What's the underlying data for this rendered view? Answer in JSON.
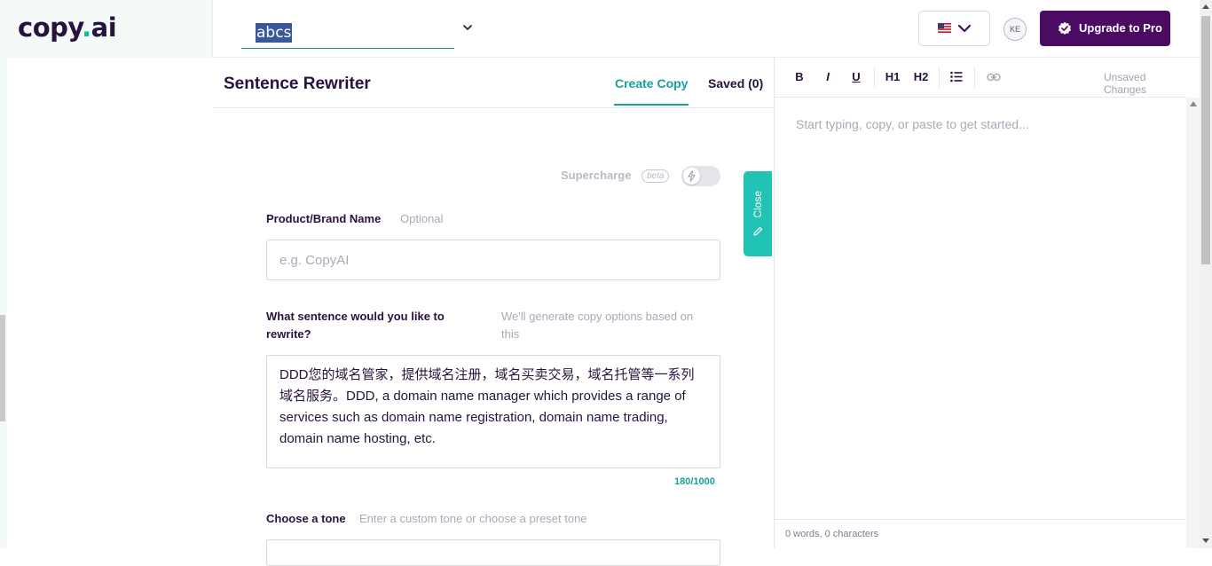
{
  "app": {
    "logo_text": "copy",
    "logo_dot": ".",
    "logo_suffix": "ai"
  },
  "header": {
    "project_name": "abcs",
    "language_flag": "US flag",
    "avatar_initials": "KE",
    "upgrade_label": "Upgrade to Pro"
  },
  "tool": {
    "title": "Sentence Rewriter",
    "tabs": [
      {
        "label": "Create Copy",
        "active": true
      },
      {
        "label": "Saved (0)",
        "active": false
      }
    ],
    "supercharge_label": "Supercharge",
    "beta_label": "beta",
    "close_label": "Close"
  },
  "form": {
    "brand": {
      "label": "Product/Brand Name",
      "hint": "Optional",
      "placeholder": "e.g. CopyAI",
      "value": ""
    },
    "sentence": {
      "label_line1": "What sentence would you like to",
      "label_line2": "rewrite?",
      "hint_line1": "We'll generate copy options based on",
      "hint_line2": "this",
      "value": "DDD您的域名管家，提供域名注册，域名买卖交易，域名托管等一系列域名服务。DDD, a domain name manager which provides a range of services such as domain name registration, domain name trading, domain name hosting, etc.",
      "char_count": "180/1000"
    },
    "tone": {
      "label": "Choose a tone",
      "hint": "Enter a custom tone or choose a preset tone"
    }
  },
  "editor": {
    "toolbar": {
      "bold": "B",
      "italic": "I",
      "underline": "U",
      "h1": "H1",
      "h2": "H2"
    },
    "status": "Unsaved Changes",
    "placeholder": "Start typing, copy, or paste to get started...",
    "word_count": "0 words, 0 characters"
  },
  "colors": {
    "accent": "#15a196",
    "brand_purple": "#4b0b63",
    "close_tab": "#21c4b4"
  }
}
